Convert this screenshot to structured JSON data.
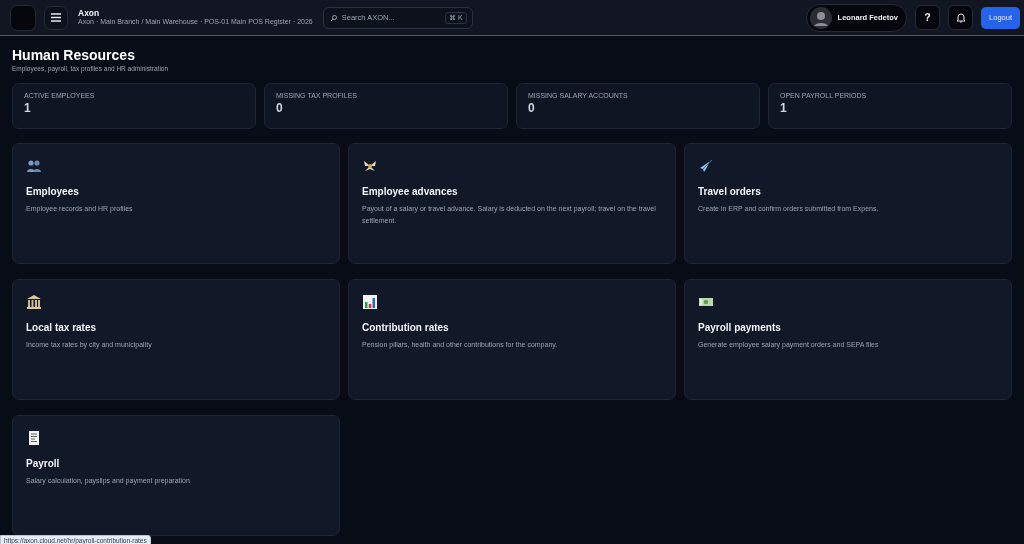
{
  "header": {
    "app_name": "Axon",
    "breadcrumb": "Axon · Main Branch / Main Warehouse · POS-01 Main POS Register · 2026",
    "search": {
      "placeholder": "Search AXON...",
      "shortcut": "⌘ K"
    },
    "user": {
      "name": "Leonard Fedetov"
    },
    "help": "?",
    "logout": "Logout"
  },
  "page": {
    "title": "Human Resources",
    "subtitle": "Employees, payroll, tax profiles and HR administration"
  },
  "stats": [
    {
      "label": "ACTIVE EMPLOYEES",
      "value": "1"
    },
    {
      "label": "MISSING TAX PROFILES",
      "value": "0"
    },
    {
      "label": "MISSING SALARY ACCOUNTS",
      "value": "0"
    },
    {
      "label": "OPEN PAYROLL PERIODS",
      "value": "1"
    }
  ],
  "modules": [
    {
      "title": "Employees",
      "description": "Employee records and HR profiles"
    },
    {
      "title": "Employee advances",
      "description": "Payout of a salary or travel advance. Salary is deducted on the next payroll; travel on the travel settlement."
    },
    {
      "title": "Travel orders",
      "description": "Create in ERP and confirm orders submitted from Expens."
    },
    {
      "title": "Local tax rates",
      "description": "Income tax rates by city and municipality"
    },
    {
      "title": "Contribution rates",
      "description": "Pension pillars, health and other contributions for the company."
    },
    {
      "title": "Payroll payments",
      "description": "Generate employee salary payment orders and SEPA files"
    },
    {
      "title": "Payroll",
      "description": "Salary calculation, payslips and payment preparation"
    }
  ],
  "status_url": "https://axon.cloud.net/hr/payroll-contribution-rates"
}
